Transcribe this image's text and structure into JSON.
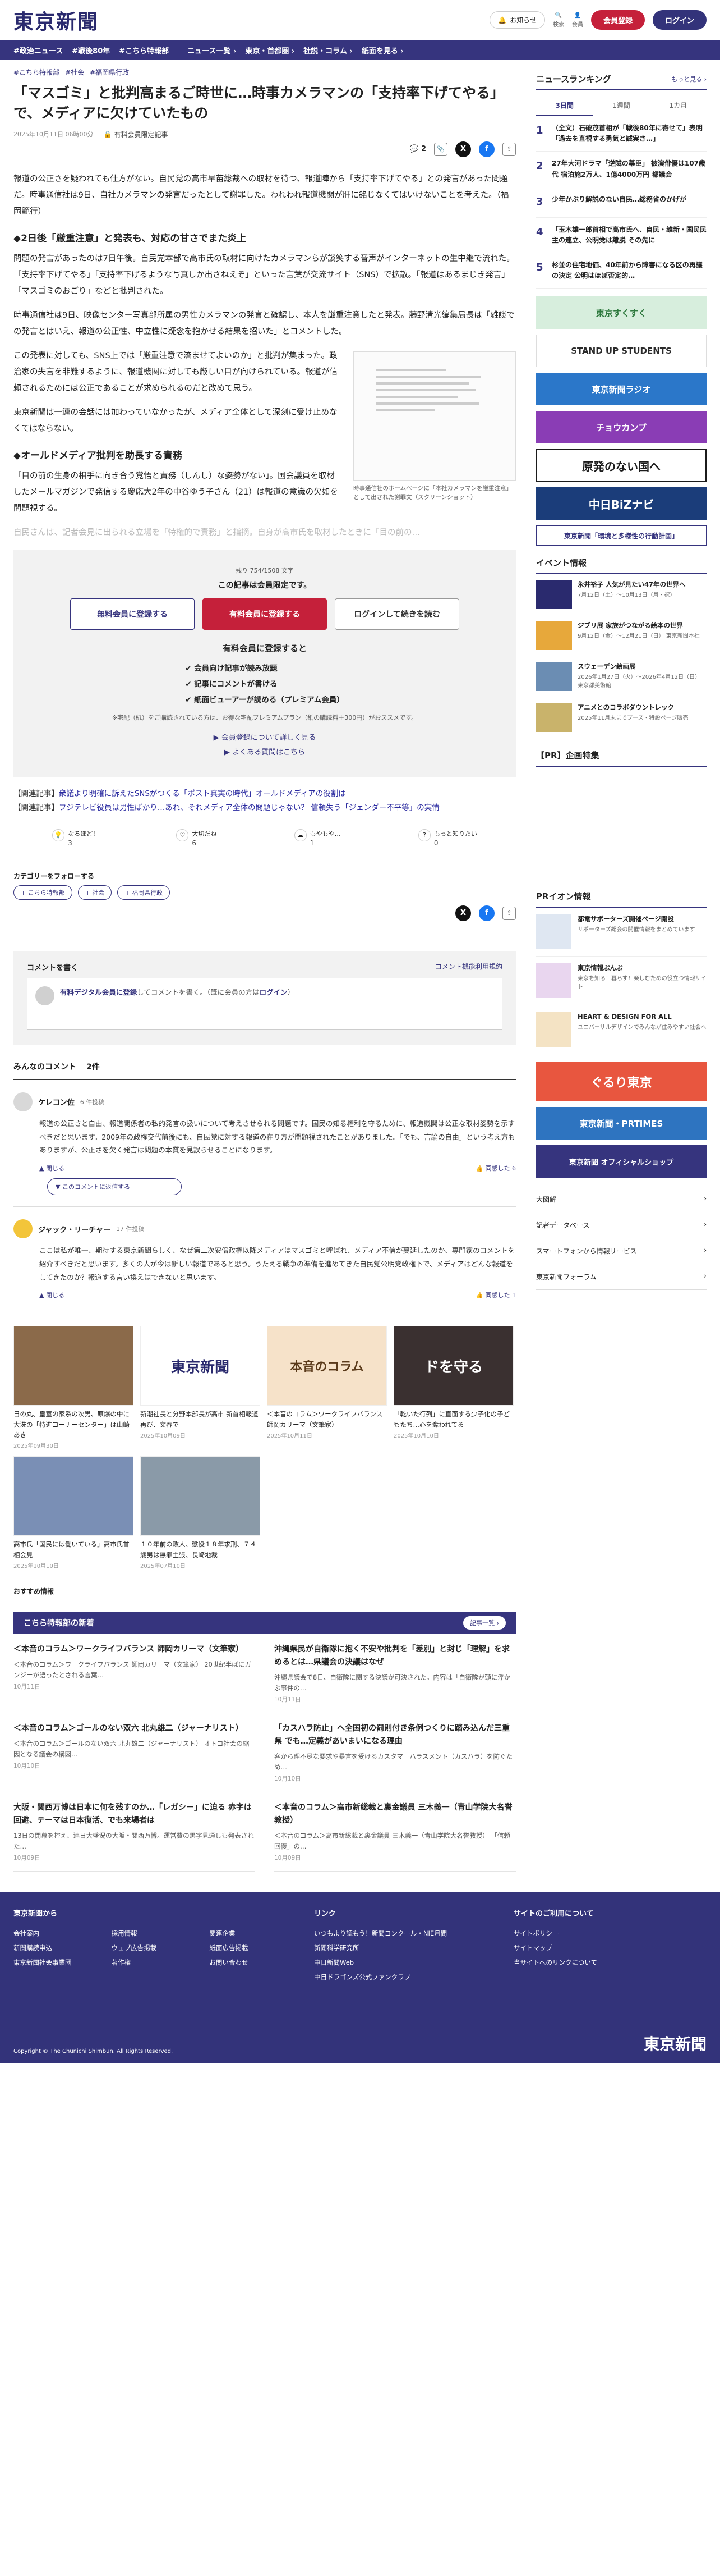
{
  "header": {
    "logo": "東京新聞",
    "follow_label": "お知らせ",
    "icons": [
      {
        "name": "search-icon",
        "label": "検索"
      },
      {
        "name": "user-icon",
        "label": "会員"
      }
    ],
    "register": "会員登録",
    "login": "ログイン"
  },
  "nav": [
    "#政治ニュース",
    "#戦後80年",
    "#こちら特報部",
    "ニュース一覧 ›",
    "東京・首都圏 ›",
    "社説・コラム ›",
    "紙面を見る ›"
  ],
  "article": {
    "tags": [
      "#こちら特報部",
      "#社会",
      "#福岡県行政"
    ],
    "title": "「マスゴミ」と批判高まるご時世に…時事カメラマンの「支持率下げてやる」で、メディアに欠けていたもの",
    "date": "2025年10月11日 06時00分",
    "badge": "有料会員限定記事",
    "comment_count": "2",
    "paragraphs": [
      "報道の公正さを疑われても仕方がない。自民党の高市早苗総裁への取材を待つ、報道陣から「支持率下げてやる」との発言があった問題だ。時事通信社は9日、自社カメラマンの発言だったとして謝罪した。われわれ報道機関が肝に銘じなくてはいけないことを考えた。（福岡範行）",
      "問題の発言があったのは7日午後。自民党本部で高市氏の取材に向けたカメラマンらが談笑する音声がインターネットの生中継で流れた。「支持率下げてやる」「支持率下げるような写真しか出さねえぞ」といった言葉が交流サイト（SNS）で拡散。「報道はあるまじき発言」「マスゴミのおごり」などと批判された。",
      "時事通信社は9日、映像センター写真部所属の男性カメラマンの発言と確認し、本人を厳重注意したと発表。藤野清光編集局長は「雑談での発言とはいえ、報道の公正性、中立性に疑念を抱かせる結果を招いた」とコメントした。",
      "この発表に対しても、SNS上では「厳重注意で済ませてよいのか」と批判が集まった。政治家の失言を非難するように、報道機関に対しても厳しい目が向けられている。報道が信頼されるためには公正であることが求められるのだと改めて思う。",
      "東京新聞は一連の会話には加わっていなかったが、メディア全体として深刻に受け止めなくてはならない。",
      "「目の前の生身の相手に向き合う覚悟と責務（しんし）な姿勢がない」。国会議員を取材したメールマガジンで発信する慶応大2年の中谷ゆう子さん（21）は報道の意識の欠如を問題視する。",
      "自民さんは、記者会見に出られる立場を「特権的で責務」と指摘。自身が高市氏を取材したときに「目の前の…"
    ],
    "h2_1": "◆2日後「厳重注意」と発表も、対応の甘さでまた炎上",
    "h2_2": "◆オールドメディア批判を助長する責務",
    "figure_caption": "時事通信社のホームページに「本社カメラマンを厳重注意」として出された謝罪文（スクリーンショット）"
  },
  "paywall": {
    "remain": "残り 754/1508 文字",
    "limited": "この記事は会員限定です。",
    "free_btn": "無料会員に登録する",
    "paid_btn": "有料会員に登録する",
    "login_btn": "ログインして続きを読む",
    "benefit_title": "有料会員に登録すると",
    "benefits": [
      "会員向け記事が読み放題",
      "記事にコメントが書ける",
      "紙面ビューアーが読める（プレミアム会員）"
    ],
    "note": "※宅配（紙）をご購読されている方は、お得な宅配プレミアムプラン（紙の購読料＋300円）がおススメです。",
    "link1": "会員登録について詳しく見る",
    "link2": "よくある質問はこちら"
  },
  "related": [
    {
      "label": "【関連記事】",
      "text": "衆議より明確に訴えたSNSがつくる「ポスト真実の時代」オールドメディアの役割は"
    },
    {
      "label": "【関連記事】",
      "text": "フジテレビ役員は男性ばかり…あれ、それメディア全体の問題じゃない？ 信頼失う「ジェンダー不平等」の実情"
    }
  ],
  "reactions": [
    {
      "label": "なるほど！",
      "count": "3"
    },
    {
      "label": "大切だね",
      "count": "6"
    },
    {
      "label": "もやもや…",
      "count": "1"
    },
    {
      "label": "もっと知りたい",
      "count": "0"
    }
  ],
  "follow": {
    "title": "カテゴリーをフォローする",
    "chips": [
      "こちら特報部",
      "社会",
      "福岡県行政"
    ]
  },
  "comment_box": {
    "title": "コメントを書く",
    "rules": "コメント機能利用規約",
    "text_pre": "有料デジタル会員に登録",
    "text_mid": "してコメントを書く。（既に会員の方は",
    "text_login": "ログイン",
    "text_post": "）"
  },
  "comments_title": "みんなのコメント",
  "comments_count": "2件",
  "comments": [
    {
      "name": "ケレコン佐",
      "count": "6 件投稿",
      "body": "報道の公正さと自由、報道関係者の私的発言の扱いについて考えさせられる問題です。国民の知る権利を守るために、報道機関は公正な取材姿勢を示すべきだと思います。2009年の政権交代前後にも、自民党に対する報道の在り方が問題視されたことがありました。「でも、言論の自由」という考え方もありますが、公正さを欠く発言は問題の本質を見誤らせることになります。",
      "agree": "同感した",
      "agree_n": "6",
      "reply": "このコメントに返信する"
    },
    {
      "name": "ジャック・リーチャー",
      "count": "17 件投稿",
      "body": "ここは私が唯一、期待する東京新聞らしく、なぜ第二次安倍政権以降メディアはマスゴミと呼ばれ、メディア不信が蔓延したのか、専門家のコメントを紹介すべきだと思います。多くの人が今は新しい報道であると思う。うたえる戦争の準備を進めてきた自民党公明党政権下で、メディアはどんな報道をしてきたのか？報道する言い換えはできないと思います。",
      "agree": "同感した",
      "agree_n": "1"
    }
  ],
  "recs": [
    {
      "title": "日の丸、皇室の家系の次男、原爆の中に大洗の「特進コーナーセンター」は山崎あき",
      "date": "2025年09月30日",
      "label": "写真",
      "color": "#8b6a4a"
    },
    {
      "title": "新潮社長と分野本部長が高市 新首相報道再び、文春で",
      "date": "2025年10月09日",
      "label": "東京新聞",
      "color": "#ffffff"
    },
    {
      "title": "＜本音のコラム＞ワークライフバランス 師岡カリーマ（文筆家）",
      "date": "2025年10月11日",
      "label": "本音のコラム",
      "color": "#f6e2c9"
    },
    {
      "title": "「乾いた行列」に直面する少子化の子どもたち…心を奪われてる",
      "date": "2025年10月10日",
      "label": "ドを守る",
      "color": "#3a3030"
    },
    {
      "title": "高市氏「国民には働いている」高市氏首相会見",
      "date": "2025年10月10日",
      "label": "写真",
      "color": "#7a8fb5"
    },
    {
      "title": "１０年前の敗人、懲役１８年求刑、７４歳男は無罪主張、長崎地裁",
      "date": "2025年07月10日",
      "label": "写真",
      "color": "#8a9aa8"
    }
  ],
  "osusume": "おすすめ情報",
  "tokuho": {
    "title": "こちら特報部の新着",
    "more": "記事一覧",
    "items": [
      {
        "title": "＜本音のコラム＞ワークライフバランス 師岡カリーマ（文筆家）",
        "sub": "＜本音のコラム＞ワークライフバランス 師岡カリーマ（文筆家） 20世紀半ばにガンジーが語ったとされる言葉…",
        "date": "10月11日"
      },
      {
        "title": "沖縄県民が自衛隊に抱く不安や批判を「差別」と封じ「理解」を求めるとは…県議会の決議はなぜ",
        "sub": "沖縄県議会で8日、自衛隊に関する決議が可決された。内容は「自衛隊が頭に浮かぶ事件の…",
        "date": "10月11日"
      },
      {
        "title": "＜本音のコラム＞ゴールのない双六 北丸雄二（ジャーナリスト）",
        "sub": "＜本音のコラム＞ゴールのない双六 北丸雄二（ジャーナリスト） オトコ社会の縮図となる議会の構図…",
        "date": "10月10日"
      },
      {
        "title": "「カスハラ防止」へ全国初の罰則付き条例つくりに踏み込んだ三重県 でも…定義があいまいになる理由",
        "sub": "客から理不尽な要求や暴言を受けるカスタマーハラスメント（カスハラ）を防ぐため…",
        "date": "10月10日"
      },
      {
        "title": "大阪・関西万博は日本に何を残すのか…「レガシー」に迫る 赤字は回避、テーマは日本復活、でも来場者は",
        "sub": "13日の閉幕を控え、連日大盛況の大阪・関西万博。運営費の黒字見通しも発表された…",
        "date": "10月09日"
      },
      {
        "title": "＜本音のコラム＞高市新総裁と裏金議員 三木義一（青山学院大名誉教授）",
        "sub": "＜本音のコラム＞高市新総裁と裏金議員 三木義一（青山学院大名誉教授） 「信頼回復」の…",
        "date": "10月09日"
      }
    ]
  },
  "sidebar": {
    "ranking_title": "ニュースランキング",
    "ranking_more": "もっと見る",
    "tabs": [
      "3日間",
      "1週間",
      "1カ月"
    ],
    "ranking": [
      "（全文）石破茂首相が「戦後80年に寄せて」表明「過去を直視する勇気と誠実さ…」",
      "27年大河ドラマ「逆賊の幕臣」 被演俳優は107歳代 宿泊施2万人、1億4000万円 都議会",
      "少年かぶり解説のない自民…総務省のかげが",
      "「玉木雄一郎首相で高市氏へ、自民・維新・国民民主の連立、公明党は離脱 その先に",
      "杉並の住宅地価、40年前から障害になる区の再議の決定 公明はほぼ否定的…"
    ],
    "banners": [
      {
        "label": "東京すくすく",
        "color": "#d7eedd",
        "fg": "#2f7a3f"
      },
      {
        "label": "STAND UP STUDENTS",
        "color": "#ffffff",
        "fg": "#2a2a2a"
      },
      {
        "label": "東京新聞ラジオ",
        "color": "#2b77c9",
        "fg": "#ffffff"
      },
      {
        "label": "チョウカンプ",
        "color": "#8a3db5",
        "fg": "#ffffff"
      },
      {
        "label": "原発のない国へ",
        "color": "#ffffff",
        "fg": "#1b1b1b"
      },
      {
        "label": "中日BiZナビ",
        "color": "#1b3d7a",
        "fg": "#ffffff"
      },
      {
        "label": "東京新聞「環境と多様性の行動計画」",
        "color": "#ffffff",
        "fg": "#36347e"
      }
    ],
    "events_title": "イベント情報",
    "events": [
      {
        "title": "永井裕子 人気が見たい47年の世界へ",
        "sub": "7月12日（土）〜10月13日（月・祝）",
        "color": "#2a2a6e"
      },
      {
        "title": "ジブリ展 家族がつながる絵本の世界",
        "sub": "9月12日（金）〜12月21日（日） 東京新聞本社",
        "color": "#e7a83b"
      },
      {
        "title": "スウェーデン絵画展",
        "sub": "2026年1月27日（火）〜2026年4月12日（日） 東京都美術館",
        "color": "#6b8db3"
      },
      {
        "title": "アニメとのコラボダウントレック",
        "sub": "2025年11月末までブース・特設ページ販売",
        "color": "#c9b36b"
      }
    ],
    "pr_title": "【PR】企画特集",
    "prinfo_title": "PRイオン情報",
    "pr": [
      {
        "title": "都電サポーターズ開催ページ開設",
        "sub": "サポーターズ総会の開催情報をまとめています"
      },
      {
        "title": "東京情報ぷんぷ",
        "sub": "東京を知る！暮らす！楽しむための役立つ情報サイト"
      },
      {
        "title": "HEART & DESIGN FOR ALL",
        "sub": "ユニバーサルデザインでみんなが住みやすい社会へ"
      }
    ],
    "banners2": [
      {
        "label": "ぐるり東京",
        "color": "#e8563f",
        "fg": "#ffffff"
      },
      {
        "label": "東京新聞・PRTIMES",
        "color": "#2e74c0",
        "fg": "#ffffff"
      },
      {
        "label": "東京新聞 オフィシャルショップ",
        "color": "#36347e",
        "fg": "#ffffff"
      }
    ],
    "links": [
      "大図解",
      "記者データベース",
      "スマートフォンから情報サービス",
      "東京新聞フォーラム"
    ]
  },
  "footer": {
    "col1_title": "東京新聞から",
    "col1_links": [
      "会社案内",
      "採用情報",
      "関連企業",
      "新聞購読申込",
      "ウェブ広告掲載",
      "紙面広告掲載",
      "東京新聞社会事業団",
      "著作権",
      "お問い合わせ"
    ],
    "col2_title": "リンク",
    "col2_links": [
      "いつもより読もう！新聞コンクール・NIE月間",
      "新聞科学研究所",
      "中日新聞Web",
      "中日ドラゴンズ公式ファンクラブ"
    ],
    "col3_title": "サイトのご利用について",
    "col3_links": [
      "サイトポリシー",
      "サイトマップ",
      "当サイトへのリンクについて"
    ],
    "logo": "東京新聞",
    "copy": "Copyright © The Chunichi Shimbun, All Rights Reserved."
  }
}
